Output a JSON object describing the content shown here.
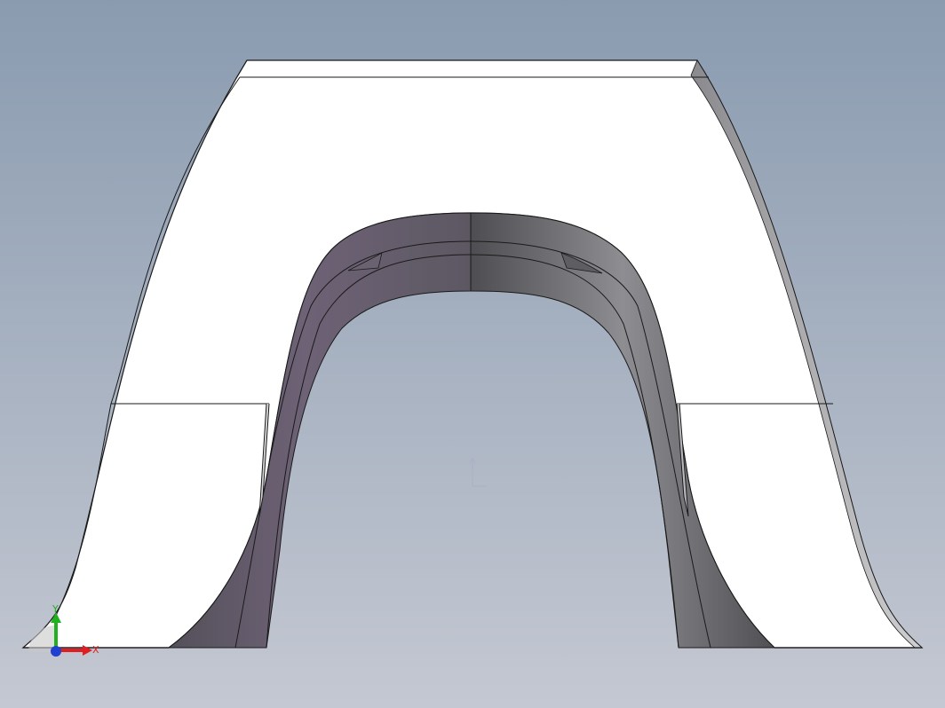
{
  "viewport": {
    "background_top": "#8a9bb0",
    "background_bottom": "#c4c8d2"
  },
  "model": {
    "face_color": "#ffffff",
    "edge_color": "#1a1a1a",
    "inner_shade_dark": "#5a5a5e",
    "inner_shade_purple": "#6e6276",
    "inner_shade_light": "#8a8a8e"
  },
  "triad": {
    "x_label": "X",
    "y_label": "Y",
    "x_color": "#e02020",
    "y_color": "#20b020",
    "z_color": "#2040d0",
    "icon": "coordinate-triad-icon"
  },
  "origin_marker": {
    "icon": "origin-marker-icon",
    "color": "#a8b2c2"
  }
}
